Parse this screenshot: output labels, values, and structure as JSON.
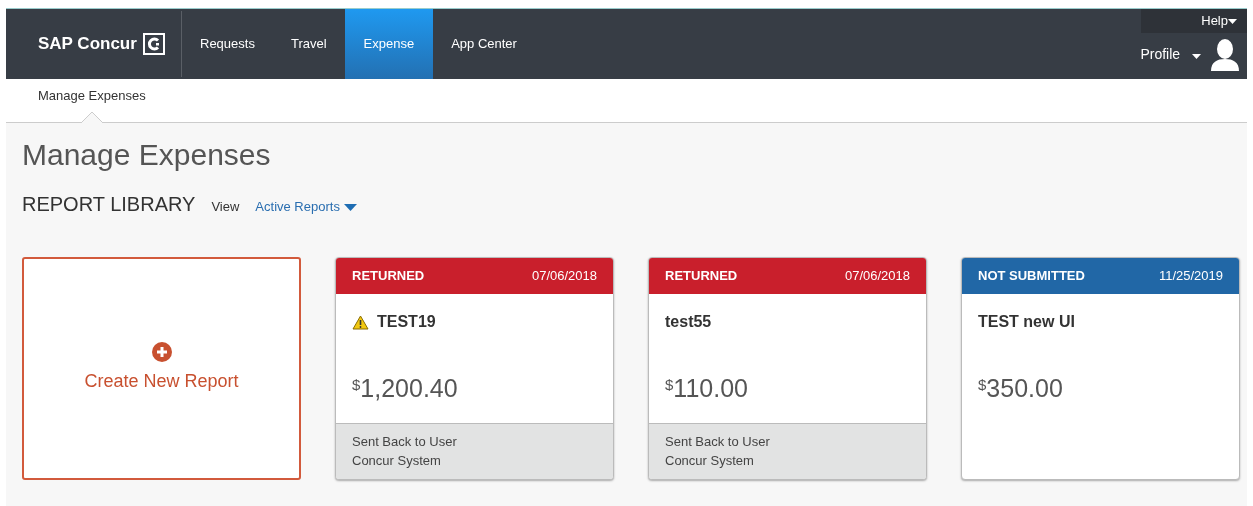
{
  "brand": {
    "name": "SAP Concur"
  },
  "nav": [
    {
      "label": "Requests",
      "selected": false
    },
    {
      "label": "Travel",
      "selected": false
    },
    {
      "label": "Expense",
      "selected": true
    },
    {
      "label": "App Center",
      "selected": false
    }
  ],
  "help": {
    "label": "Help"
  },
  "profile": {
    "label": "Profile"
  },
  "subnav": [
    {
      "label": "Manage Expenses",
      "selected": true
    }
  ],
  "page_title": "Manage Expenses",
  "library": {
    "title": "REPORT LIBRARY",
    "view_label": "View",
    "view_value": "Active Reports"
  },
  "create": {
    "label": "Create New Report"
  },
  "reports": [
    {
      "status": "RETURNED",
      "kind": "returned",
      "date": "07/06/2018",
      "warning": true,
      "title": "TEST19",
      "currency": "$",
      "amount": "1,200.40",
      "footer": [
        "Sent Back to User",
        "Concur System"
      ]
    },
    {
      "status": "RETURNED",
      "kind": "returned",
      "date": "07/06/2018",
      "warning": false,
      "title": "test55",
      "currency": "$",
      "amount": "110.00",
      "footer": [
        "Sent Back to User",
        "Concur System"
      ]
    },
    {
      "status": "NOT SUBMITTED",
      "kind": "not_submitted",
      "date": "11/25/2019",
      "warning": false,
      "title": "TEST new UI",
      "currency": "$",
      "amount": "350.00"
    }
  ]
}
